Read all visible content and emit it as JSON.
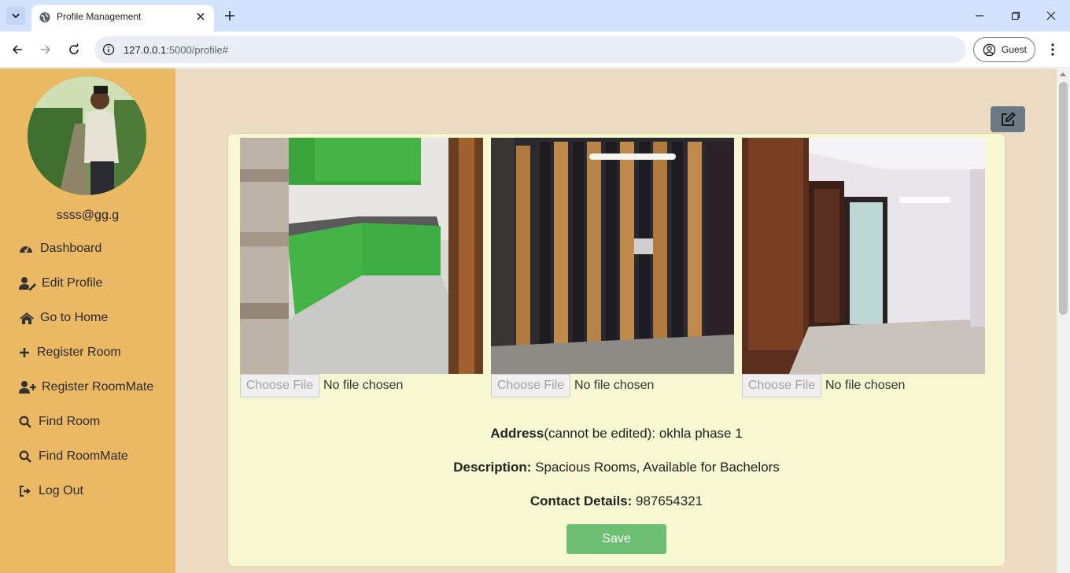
{
  "browser": {
    "tab_title": "Profile Management",
    "url_host": "127.0.0.1",
    "url_rest": ":5000/profile#",
    "profile_label": "Guest"
  },
  "sidebar": {
    "user_email": "ssss@gg.g",
    "items": [
      {
        "label": "Dashboard",
        "icon": "dashboard-icon"
      },
      {
        "label": "Edit Profile",
        "icon": "user-edit-icon"
      },
      {
        "label": "Go to Home",
        "icon": "home-icon"
      },
      {
        "label": "Register Room",
        "icon": "plus-icon"
      },
      {
        "label": "Register RoomMate",
        "icon": "user-plus-icon"
      },
      {
        "label": "Find Room",
        "icon": "search-icon"
      },
      {
        "label": "Find RoomMate",
        "icon": "search-icon"
      },
      {
        "label": "Log Out",
        "icon": "logout-icon"
      }
    ]
  },
  "room": {
    "photos": [
      {
        "subject": "green kitchen cabinets",
        "button": "Choose File",
        "status": "No file chosen"
      },
      {
        "subject": "striped wooden wall panel",
        "button": "Choose File",
        "status": "No file chosen"
      },
      {
        "subject": "room with door and bathroom",
        "button": "Choose File",
        "status": "No file chosen"
      }
    ],
    "address_label": "Address",
    "address_note": "(cannot be edited): okhla phase 1",
    "description_label": "Description:",
    "description_value": " Spacious Rooms, Available for Bachelors",
    "contact_label": "Contact Details:",
    "contact_value": " 987654321",
    "save_label": "Save"
  },
  "colors": {
    "sidebar": "#ebb864",
    "page_bg": "#ecdcc3",
    "card_bg": "#f7f7d1",
    "save_button": "#6dbf73",
    "edit_button": "#6c7a86"
  }
}
